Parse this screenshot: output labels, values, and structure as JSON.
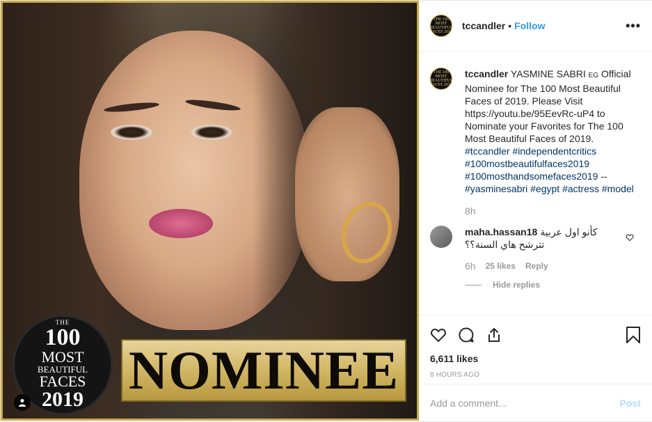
{
  "post": {
    "username": "tccandler",
    "separator": "•",
    "follow_label": "Follow",
    "more_label": "•••",
    "avatar_text": "THE 100 MOST BEAUTIFUL FACES 2019",
    "media": {
      "seal": {
        "the": "THE",
        "num": "100",
        "most": "MOST",
        "beautiful": "BEAUTIFUL",
        "faces": "FACES",
        "year": "2019"
      },
      "banner_text": "NOMINEE",
      "tag_icon": "user-tag-icon"
    },
    "caption": {
      "username": "tccandler",
      "text": "YASMINE SABRI ",
      "flag": "EG",
      "text2": " Official Nominee for The 100 Most Beautiful Faces of 2019. Please Visit https://youtu.be/95EevRc-uP4 to Nominate your Favorites for The 100 Most Beautiful Faces of 2019.",
      "hashtags1": "#tccandler #independentcritics #100mostbeautifulfaces2019 #100mosthandsomefaces2019",
      "dashes": " --",
      "hashtags2": "#yasminesabri #egypt #actress #model",
      "age": "8h"
    },
    "comment": {
      "username": "maha.hassan18",
      "text": "كأنو اول عربية تترشح هاي السنة؟؟",
      "age": "6h",
      "likes": "25 likes",
      "reply_label": "Reply",
      "hide_replies_label": "Hide replies"
    },
    "likes": "6,611 likes",
    "timestamp": "8 HOURS AGO",
    "add_comment_placeholder": "Add a comment...",
    "post_label": "Post"
  },
  "colors": {
    "link": "#3897f0",
    "hashtag": "#003569",
    "muted": "#999999",
    "post_disabled": "#b2dffc",
    "frame_gold": "#c8a94a"
  }
}
